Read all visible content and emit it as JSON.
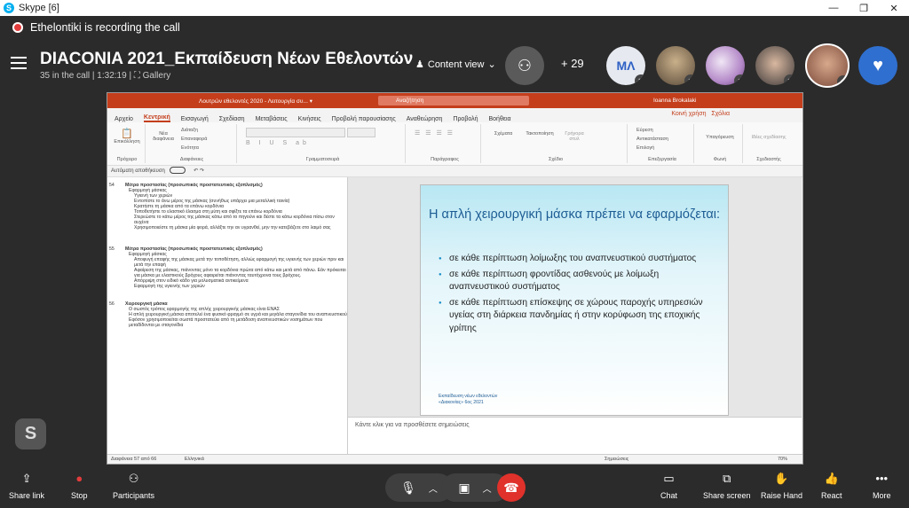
{
  "window": {
    "app_title": "Skype [6]",
    "min": "—",
    "max": "❐",
    "close": "✕"
  },
  "recording": {
    "text": "Ethelontiki is recording the call"
  },
  "call": {
    "title": "DIACONIA 2021_Εκπαίδευση Νέων Εθελοντών",
    "subtitle": "35 in the call | 1:32:19 | ⛶ Gallery",
    "content_view": "Content view",
    "participant_count": "+ 29",
    "avatar_initials": "ΜΛ"
  },
  "ppt": {
    "doc_title": "Λουτρών εθελοντές 2020 - Λειτουργία συ... ▾",
    "search_placeholder": "Αναζήτηση",
    "user": "Ioanna Brokalaki",
    "share": "Κοινή χρήση",
    "comments": "Σχόλια",
    "tabs": [
      "Αρχείο",
      "Κεντρική",
      "Εισαγωγή",
      "Σχεδίαση",
      "Μεταβάσεις",
      "Κινήσεις",
      "Προβολή παρουσίασης",
      "Αναθεώρηση",
      "Προβολή",
      "Βοήθεια"
    ],
    "ribbon_groups": [
      "Πρόχειρο",
      "Διαφάνειες",
      "Γραμματοσειρά",
      "Παράγραφος",
      "Σχέδιο",
      "Επεξεργασία",
      "Φωνή",
      "Σχεδιαστής"
    ],
    "ribbon_buttons": [
      "Επικόλληση",
      "Νέα διαφάνεια",
      "Διάταξη",
      "Επαναφορά",
      "Ενότητα",
      "Σχέματα",
      "Τακτοποίηση",
      "Γρήγορα στυλ",
      "Εύρεση",
      "Αντικατάσταση",
      "Επιλογή",
      "Υπαγόρευση",
      "Ιδέες σχεδίασης"
    ],
    "autosave": "Αυτόματη αποθήκευση",
    "outline": [
      {
        "num": "54",
        "title": "Μέτρα προστασίας (προσωπικός προστατευτικός εξοπλισμός)",
        "l1": [
          "Εφαρμογή μάσκας"
        ],
        "l2": [
          "Υγιεινή των χεριών",
          "Εντοπίστε το άνω μέρος της μάσκας (συνήθως υπάρχει μια μεταλλική ταινία)",
          "Κρατήστε τη μάσκα από τα επάνω κορδόνια",
          "Τοποθετήστε το ελαστικό έλασμα στη μύτη και σφίξτε τα επάνω κορδόνια",
          "Στερεώστε το κάτω μέρος της μάσκας κάτω από το πηγούνι και δέστε τα κάτω κορδόνια πίσω στον αυχένα",
          "Χρησιμοποιείστε τη μάσκα μία φορά, αλλάξτε την αν υγρανθεί, μην την κατεβάζετε στο λαιμό σας"
        ]
      },
      {
        "num": "55",
        "title": "Μέτρα προστασίας (προσωπικός προστατευτικός εξοπλισμός)",
        "l1": [
          "Εφαρμογή μάσκας"
        ],
        "l2": [
          "Αποφυγή επαφής της μάσκας μετά την τοποθέτηση, αλλιώς εφαρμογή της υγιεινής των χεριών πριν και μετά την επαφή",
          "Αφαίρεση της μάσκας, πιάνοντας μόνο τα κορδόνια πρώτα από κάτω και μετά από πάνω. Εάν πρόκειται για μάσκα με ελαστικούς βρόχους αφαιρείται πιάνοντας ταυτόχρονα τους βρόχους.",
          "Απόρριψη στον ειδικό κάδο για μολυσματικά αντικείμενα",
          "Εφαρμογή της υγιεινής των χεριών"
        ]
      },
      {
        "num": "56",
        "title": "Χειρουργική μάσκα",
        "l1": [
          "Ο σωστός τρόπος εφαρμογής της απλής χειρουργικής μάσκας είναι ΕΝΑΣ",
          "Η απλή χειρουργική μάσκα αποτελεί ένα φυσικό φραγμό σε υγρά και μεγάλα σταγονίδια του αναπνευστικού",
          "Εφόσον χρησιμοποιείται σωστά προστατεύει από τη μετάδοση αναπνευστικών νοσημάτων που μεταδίδονται με σταγονίδια"
        ],
        "l2": []
      }
    ],
    "slide": {
      "title": "Η απλή χειρουργική μάσκα πρέπει να εφαρμόζεται:",
      "bullets": [
        "σε κάθε περίπτωση λοίμωξης του αναπνευστικού συστήματος",
        "σε κάθε περίπτωση φροντίδας ασθενούς με λοίμωξη αναπνευστικού συστήματος",
        "σε κάθε περίπτωση επίσκεψης σε χώρους παροχής υπηρεσιών υγείας στη διάρκεια πανδημίας ή στην κορύφωση της εποχικής γρίπης"
      ],
      "footer_1": "Εκπαίδευση νέων εθελοντών",
      "footer_2": "«Διακονίας» 6ος 2021"
    },
    "notes_placeholder": "Κάντε κλικ για να προσθέσετε σημειώσεις",
    "status_left": "Διαφάνεια 57 από 66",
    "status_lang": "Ελληνικά",
    "status_notes": "Σημειώσεις",
    "zoom": "70%"
  },
  "bottom": {
    "share_link": "Share link",
    "stop": "Stop",
    "participants": "Participants",
    "chat": "Chat",
    "share_screen": "Share screen",
    "raise_hand": "Raise Hand",
    "react": "React",
    "more": "More"
  },
  "colors": {
    "accent": "#c43e1c",
    "skype": "#00aff0",
    "hangup": "#e0312b",
    "slide_title": "#1d5c94"
  }
}
